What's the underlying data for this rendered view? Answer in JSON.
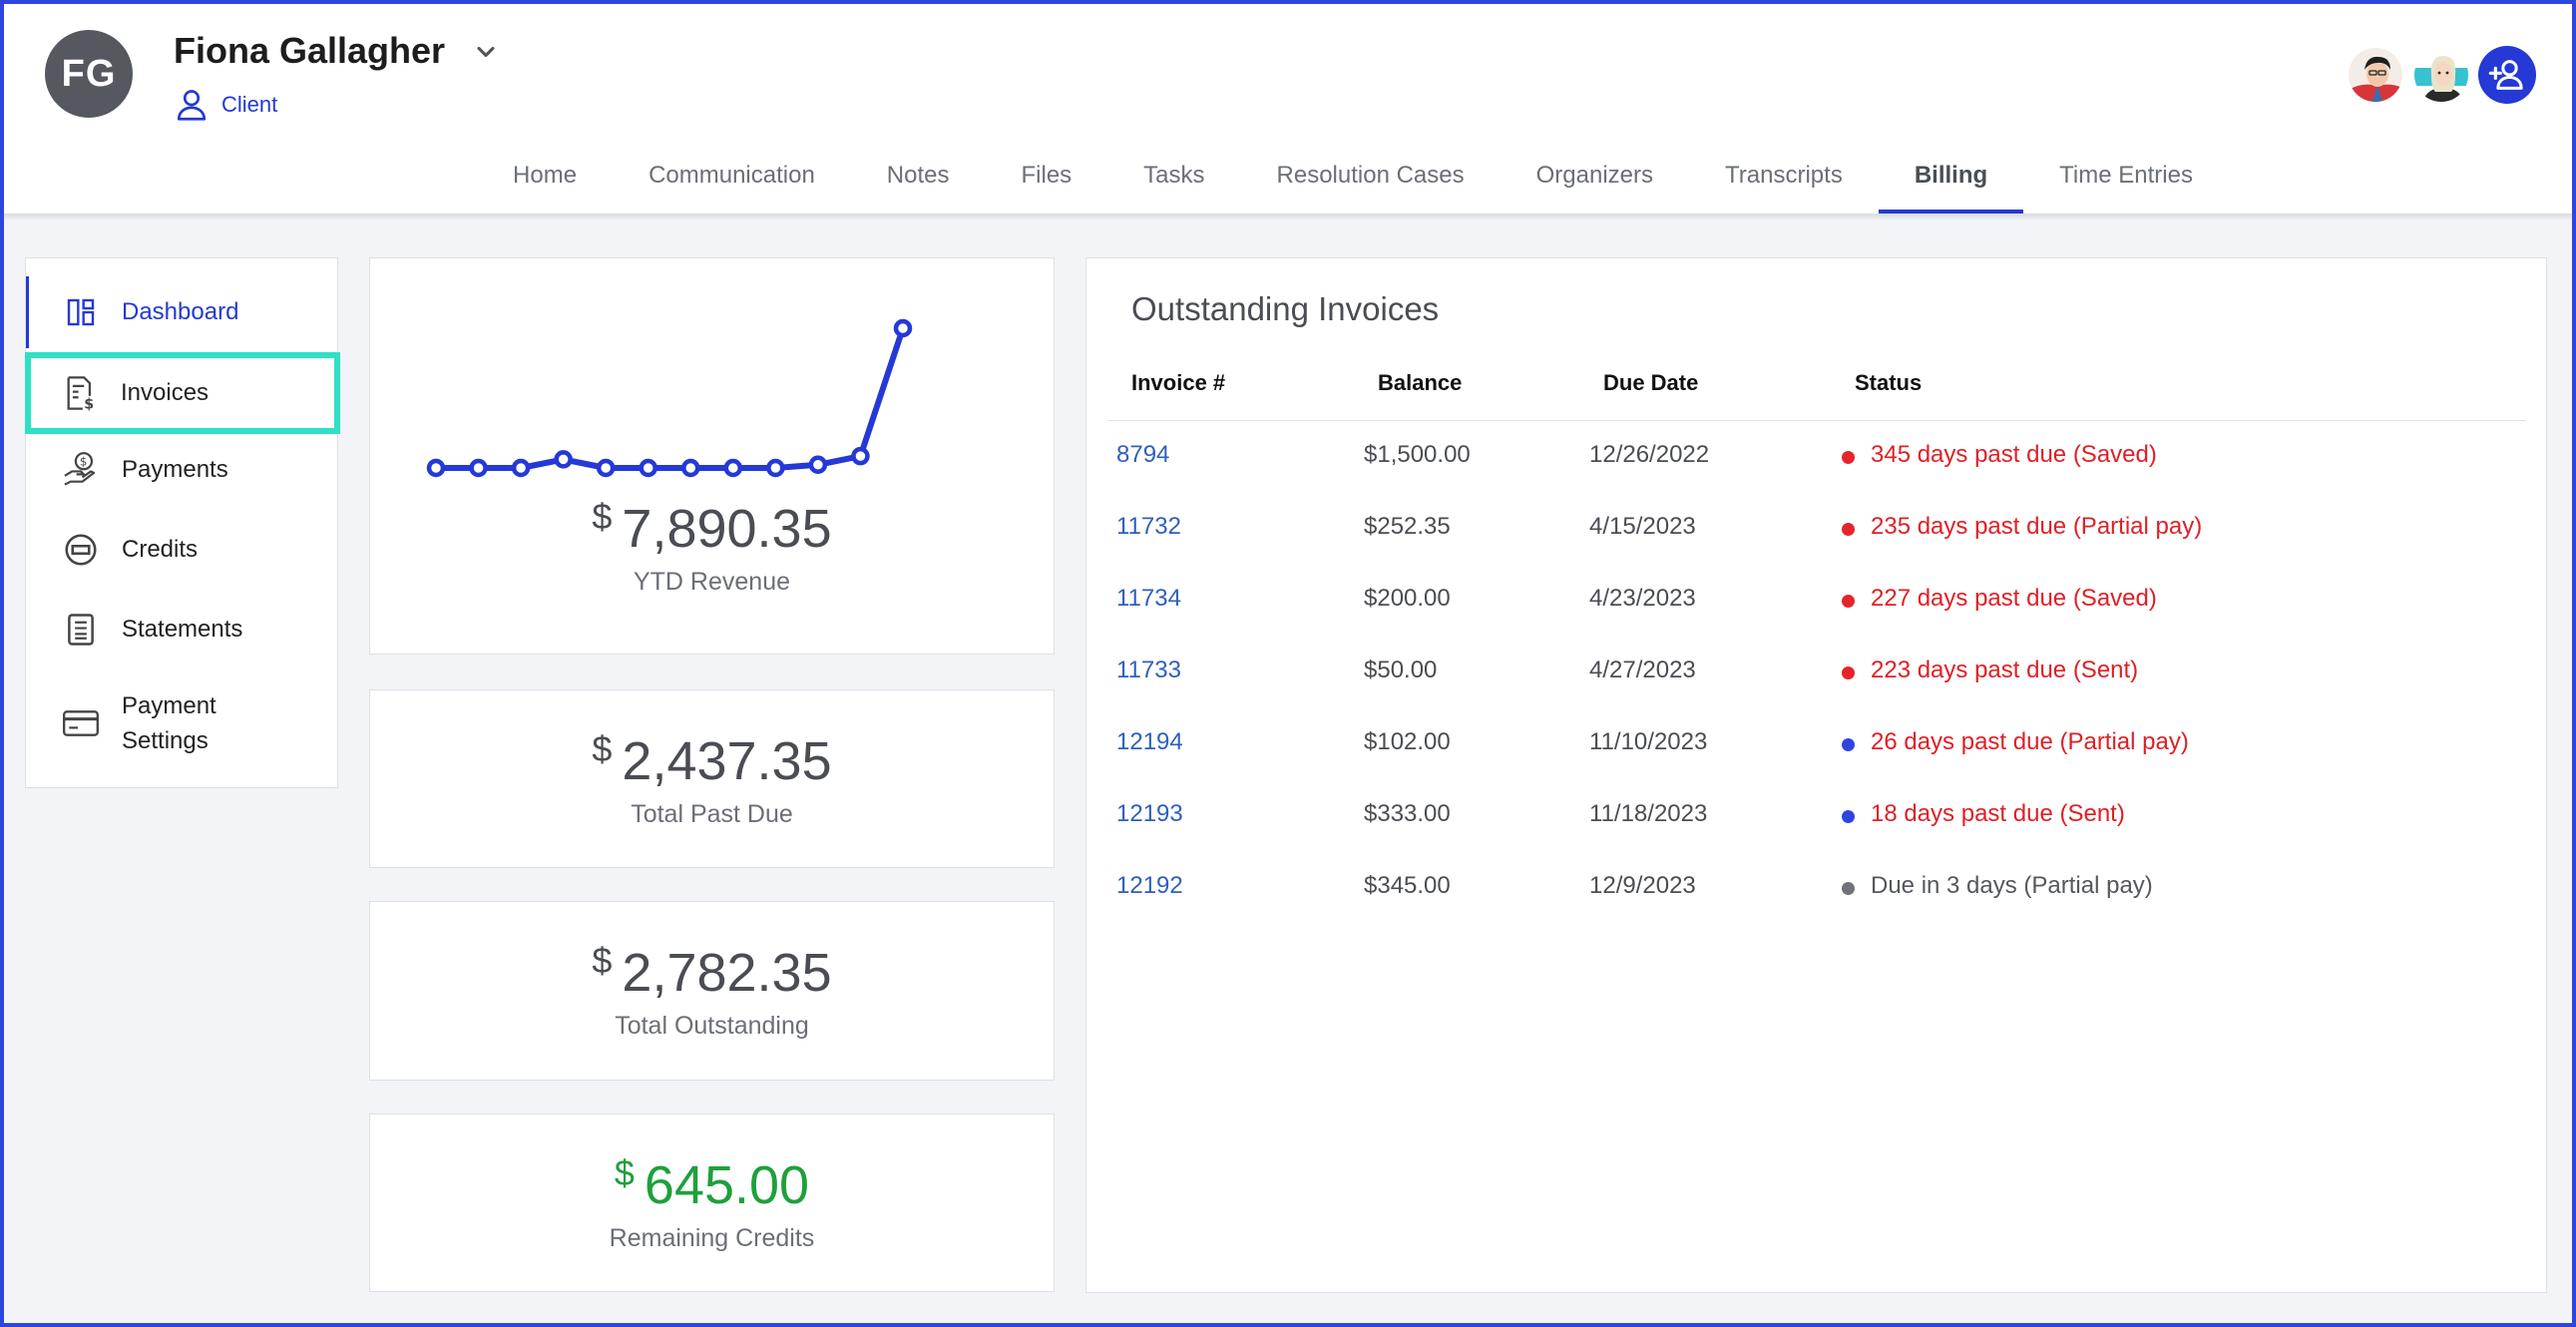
{
  "header": {
    "initials": "FG",
    "name": "Fiona Gallagher",
    "role": "Client",
    "tabs": [
      "Home",
      "Communication",
      "Notes",
      "Files",
      "Tasks",
      "Resolution Cases",
      "Organizers",
      "Transcripts",
      "Billing",
      "Time Entries"
    ],
    "active_tab": "Billing"
  },
  "sidebar": {
    "items": [
      {
        "label": "Dashboard",
        "icon": "dashboard-icon"
      },
      {
        "label": "Invoices",
        "icon": "invoice-icon"
      },
      {
        "label": "Payments",
        "icon": "payment-hand-icon"
      },
      {
        "label": "Credits",
        "icon": "credit-minus-icon"
      },
      {
        "label": "Statements",
        "icon": "statement-icon"
      },
      {
        "label": "Payment Settings",
        "icon": "credit-card-icon"
      }
    ]
  },
  "stats": {
    "ytd": {
      "currency": "$",
      "amount": "7,890.35",
      "label": "YTD Revenue"
    },
    "past_due": {
      "currency": "$",
      "amount": "2,437.35",
      "label": "Total Past Due"
    },
    "outstanding": {
      "currency": "$",
      "amount": "2,782.35",
      "label": "Total Outstanding"
    },
    "credits": {
      "currency": "$",
      "amount": "645.00",
      "label": "Remaining Credits"
    }
  },
  "chart_data": {
    "type": "line",
    "series": [
      {
        "values": [
          1,
          1,
          1,
          1.8,
          1,
          1,
          1,
          1,
          1,
          1.3,
          2.1,
          14
        ]
      }
    ],
    "color": "#2439d6"
  },
  "invoices": {
    "title": "Outstanding Invoices",
    "columns": [
      "Invoice #",
      "Balance",
      "Due Date",
      "Status"
    ],
    "rows": [
      {
        "num": "8794",
        "balance": "$1,500.00",
        "due": "12/26/2022",
        "status": "345 days past due (Saved)",
        "dot": "#e5252a",
        "status_color": "#e01f26"
      },
      {
        "num": "11732",
        "balance": "$252.35",
        "due": "4/15/2023",
        "status": "235 days past due (Partial pay)",
        "dot": "#e5252a",
        "status_color": "#e01f26"
      },
      {
        "num": "11734",
        "balance": "$200.00",
        "due": "4/23/2023",
        "status": "227 days past due (Saved)",
        "dot": "#e5252a",
        "status_color": "#e01f26"
      },
      {
        "num": "11733",
        "balance": "$50.00",
        "due": "4/27/2023",
        "status": "223 days past due (Sent)",
        "dot": "#e5252a",
        "status_color": "#e01f26"
      },
      {
        "num": "12194",
        "balance": "$102.00",
        "due": "11/10/2023",
        "status": "26 days past due (Partial pay)",
        "dot": "#2f45e0",
        "status_color": "#e01f26"
      },
      {
        "num": "12193",
        "balance": "$333.00",
        "due": "11/18/2023",
        "status": "18 days past due (Sent)",
        "dot": "#2f45e0",
        "status_color": "#e01f26"
      },
      {
        "num": "12192",
        "balance": "$345.00",
        "due": "12/9/2023",
        "status": "Due in 3 days (Partial pay)",
        "dot": "#707479",
        "status_color": "#55585e"
      }
    ]
  }
}
